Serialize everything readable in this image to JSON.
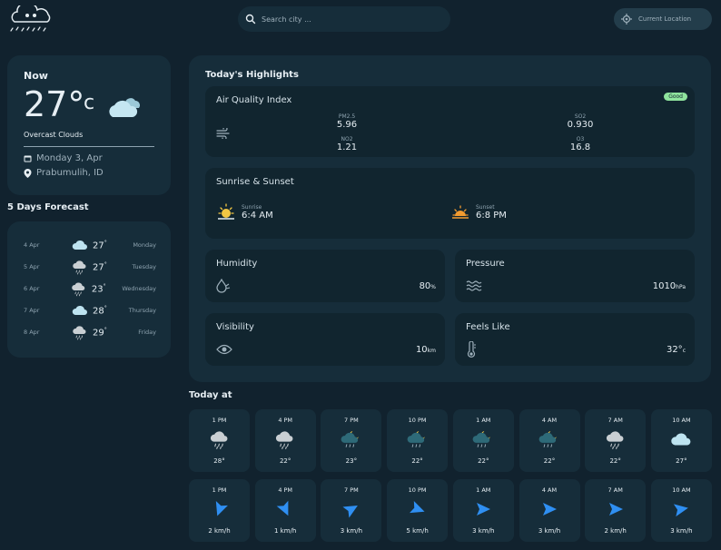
{
  "header": {
    "search_placeholder": "Search city ...",
    "current_location_label": "Current Location",
    "logo_icon": "cloud-rain-logo-icon"
  },
  "now": {
    "title": "Now",
    "temp": "27°",
    "unit": "c",
    "description": "Overcast Clouds",
    "date": "Monday 3, Apr",
    "location": "Prabumulih, ID",
    "icon": "overcast-cloud-icon"
  },
  "forecast": {
    "title": "5 Days Forecast",
    "items": [
      {
        "date": "4 Apr",
        "temp": "27",
        "day": "Monday",
        "icon": "cloud-icon"
      },
      {
        "date": "5 Apr",
        "temp": "27",
        "day": "Tuesday",
        "icon": "rain-cloud-icon"
      },
      {
        "date": "6 Apr",
        "temp": "23",
        "day": "Wednesday",
        "icon": "rain-cloud-icon"
      },
      {
        "date": "7 Apr",
        "temp": "28",
        "day": "Thursday",
        "icon": "cloud-icon"
      },
      {
        "date": "8 Apr",
        "temp": "29",
        "day": "Friday",
        "icon": "rain-cloud-icon"
      }
    ]
  },
  "highlights": {
    "title": "Today's Highlights",
    "air_quality": {
      "label": "Air Quality Index",
      "badge": "Good",
      "pm25_label": "PM2.5",
      "pm25_value": "5.96",
      "so2_label": "SO2",
      "so2_value": "0.930",
      "no2_label": "NO2",
      "no2_value": "1.21",
      "o3_label": "O3",
      "o3_value": "16.8"
    },
    "sun": {
      "label": "Sunrise & Sunset",
      "sunrise_label": "Sunrise",
      "sunrise_time": "6:4 AM",
      "sunset_label": "Sunset",
      "sunset_time": "6:8 PM"
    },
    "humidity": {
      "label": "Humidity",
      "value": "80",
      "unit": "%"
    },
    "pressure": {
      "label": "Pressure",
      "value": "1010",
      "unit": "hPa"
    },
    "visibility": {
      "label": "Visibility",
      "value": "10",
      "unit": "km"
    },
    "feels_like": {
      "label": "Feels Like",
      "value": "32°",
      "unit": "c"
    }
  },
  "today": {
    "title": "Today at",
    "temps": [
      {
        "time": "1 PM",
        "value": "28°",
        "icon": "rain-cloud-icon"
      },
      {
        "time": "4 PM",
        "value": "22°",
        "icon": "rain-cloud-icon"
      },
      {
        "time": "7 PM",
        "value": "23°",
        "icon": "night-rain-icon"
      },
      {
        "time": "10 PM",
        "value": "22°",
        "icon": "night-rain-icon"
      },
      {
        "time": "1 AM",
        "value": "22°",
        "icon": "night-rain-icon"
      },
      {
        "time": "4 AM",
        "value": "22°",
        "icon": "night-rain-icon"
      },
      {
        "time": "7 AM",
        "value": "22°",
        "icon": "rain-cloud-icon"
      },
      {
        "time": "10 AM",
        "value": "27°",
        "icon": "cloud-icon"
      }
    ],
    "winds": [
      {
        "time": "1 PM",
        "value": "2 km/h",
        "deg": 200
      },
      {
        "time": "4 PM",
        "value": "1 km/h",
        "deg": 155
      },
      {
        "time": "7 PM",
        "value": "3 km/h",
        "deg": 60
      },
      {
        "time": "10 PM",
        "value": "5 km/h",
        "deg": 110
      },
      {
        "time": "1 AM",
        "value": "3 km/h",
        "deg": 90
      },
      {
        "time": "4 AM",
        "value": "3 km/h",
        "deg": 90
      },
      {
        "time": "7 AM",
        "value": "2 km/h",
        "deg": 90
      },
      {
        "time": "10 AM",
        "value": "3 km/h",
        "deg": 80
      }
    ]
  },
  "colors": {
    "background": "#11222e",
    "card": "#162d3a",
    "accent": "#8fe39d",
    "wind": "#2f8ff2"
  }
}
